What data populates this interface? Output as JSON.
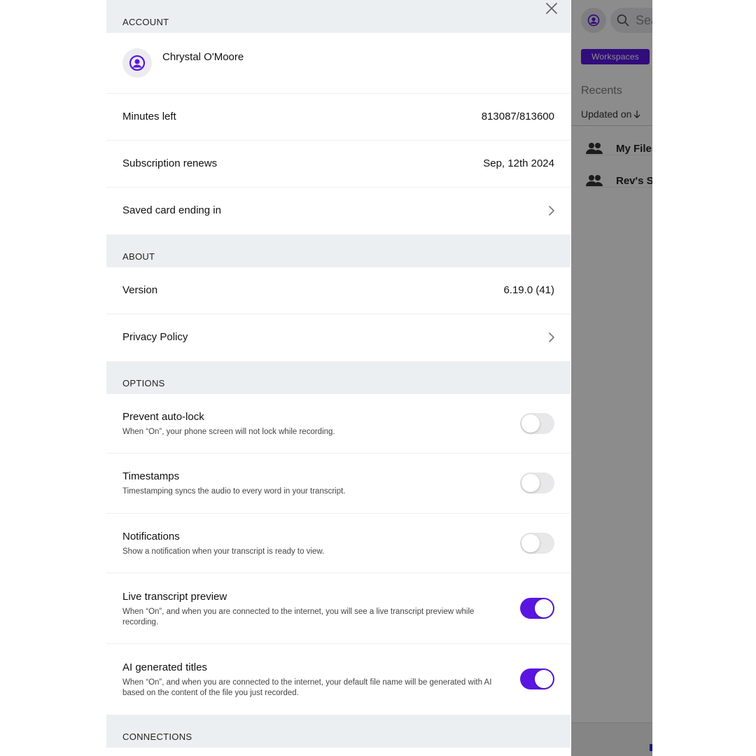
{
  "account": {
    "header": "ACCOUNT",
    "user_name": "Chrystal O'Moore",
    "minutes_label": "Minutes left",
    "minutes_value": "813087/813600",
    "subscription_label": "Subscription renews",
    "subscription_value": "Sep, 12th 2024",
    "card_label": "Saved card ending in"
  },
  "about": {
    "header": "ABOUT",
    "version_label": "Version",
    "version_value": "6.19.0 (41)",
    "privacy_label": "Privacy Policy"
  },
  "options": {
    "header": "OPTIONS",
    "items": [
      {
        "title": "Prevent auto-lock",
        "desc": "When “On”, your phone screen will not lock while recording.",
        "on": false
      },
      {
        "title": "Timestamps",
        "desc": "Timestamping syncs the audio to every word in your transcript.",
        "on": false
      },
      {
        "title": "Notifications",
        "desc": "Show a notification when your transcript is ready to view.",
        "on": false
      },
      {
        "title": "Live transcript preview",
        "desc": "When “On”, and when you are connected to the internet, you will see a live transcript preview while recording.",
        "on": true
      },
      {
        "title": "AI generated titles",
        "desc": "When “On”, and when you are connected to the internet, your default file name will be generated with AI based on the content of the file you just recorded.",
        "on": true
      }
    ]
  },
  "connections": {
    "header": "CONNECTIONS"
  },
  "background_app": {
    "search_placeholder": "Sea",
    "workspaces_button": "Workspaces",
    "recents_title": "Recents",
    "sort_label": "Updated on",
    "rows": [
      "My Files",
      "Rev's Sh"
    ]
  },
  "colors": {
    "accent": "#5a16e0",
    "panel_bg": "#eceff1",
    "toggle_off": "#e8e8ea"
  }
}
